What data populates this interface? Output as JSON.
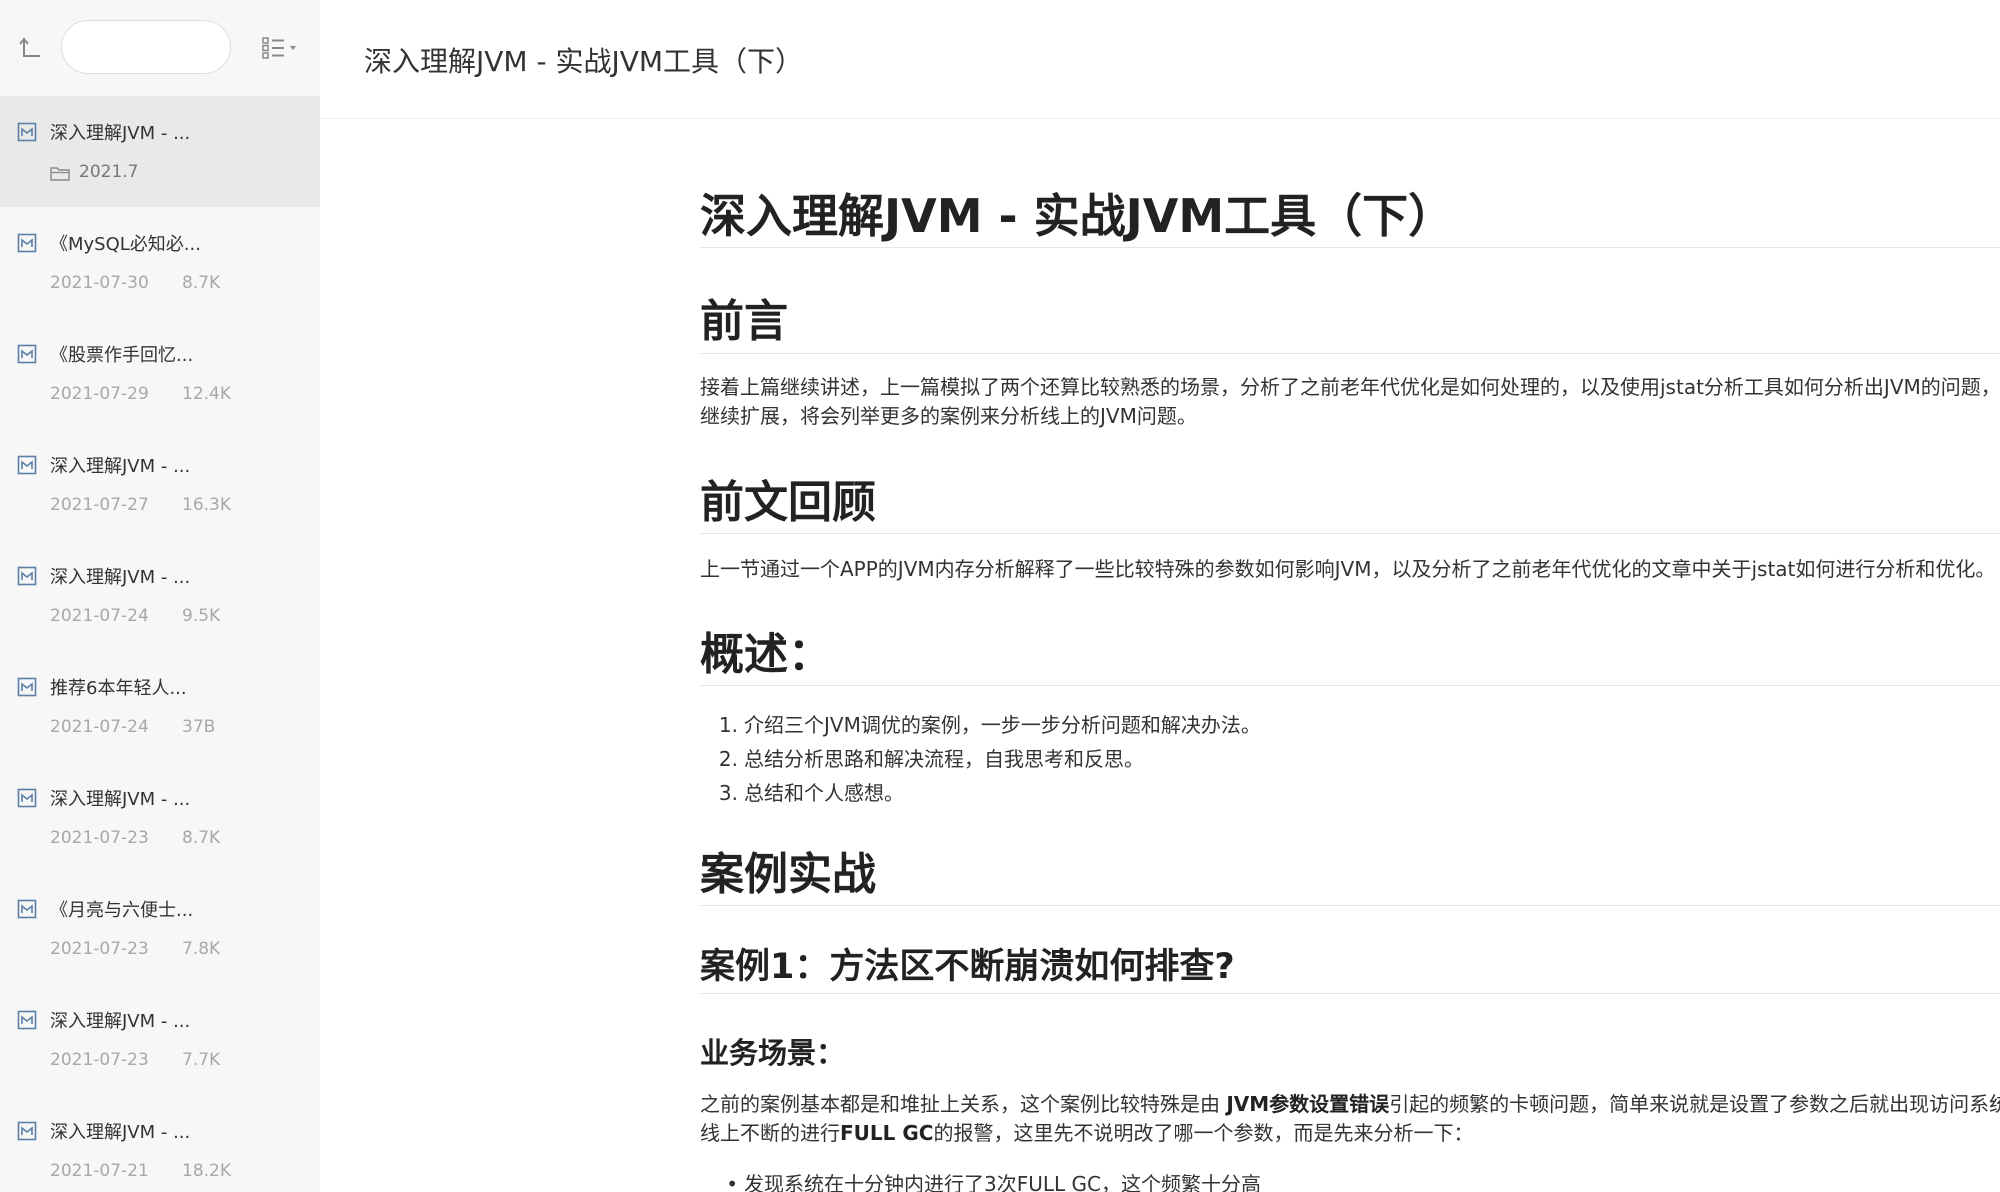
{
  "sidebar": {
    "search_value": "",
    "items": [
      {
        "title": "深入理解JVM - ...",
        "folder": "2021.7",
        "active": true
      },
      {
        "title": "《MySQL必知必...",
        "date": "2021-07-30",
        "size": "8.7K"
      },
      {
        "title": "《股票作手回忆...",
        "date": "2021-07-29",
        "size": "12.4K"
      },
      {
        "title": "深入理解JVM - ...",
        "date": "2021-07-27",
        "size": "16.3K"
      },
      {
        "title": "深入理解JVM - ...",
        "date": "2021-07-24",
        "size": "9.5K"
      },
      {
        "title": "推荐6本年轻人...",
        "date": "2021-07-24",
        "size": "37B"
      },
      {
        "title": "深入理解JVM - ...",
        "date": "2021-07-23",
        "size": "8.7K"
      },
      {
        "title": "《月亮与六便士...",
        "date": "2021-07-23",
        "size": "7.8K"
      },
      {
        "title": "深入理解JVM - ...",
        "date": "2021-07-23",
        "size": "7.7K"
      },
      {
        "title": "深入理解JVM - ...",
        "date": "2021-07-21",
        "size": "18.2K"
      }
    ]
  },
  "header": {
    "title": "深入理解JVM - 实战JVM工具（下）"
  },
  "article": {
    "h1": "深入理解JVM - 实战JVM工具（下）",
    "preface": {
      "heading": "前言",
      "para_line1": " 接着上篇继续讲述，上一篇模拟了两个还算比较熟悉的场景，分析了之前老年代优化是如何处理的，以及使用jstat分析工具如何分析出JVM的问题，这一",
      "para_line2": "继续扩展，将会列举更多的案例来分析线上的JVM问题。"
    },
    "review": {
      "heading": "前文回顾",
      "para": " 上一节通过一个APP的JVM内存分析解释了一些比较特殊的参数如何影响JVM，以及分析了之前老年代优化的文章中关于jstat如何进行分析和优化。"
    },
    "overview": {
      "heading": "概述：",
      "items": [
        {
          "num": "1.",
          "text": "介绍三个JVM调优的案例，一步一步分析问题和解决办法。"
        },
        {
          "num": "2.",
          "text": "总结分析思路和解决流程，自我思考和反思。"
        },
        {
          "num": "3.",
          "text": "总结和个人感想。"
        }
      ]
    },
    "cases": {
      "heading": "案例实战",
      "case1_heading": "案例1：方法区不断崩溃如何排查?",
      "biz_heading": "业务场景：",
      "biz_line1_a": " 之前的案例基本都是和堆扯上关系，这个案例比较特殊是由 ",
      "biz_line1_bold": "JVM参数设置错误",
      "biz_line1_b": "引起的频繁的卡顿问题，简单来说就是设置了参数之后就出现访问系统卡",
      "biz_line2_a": "线上不断的进行",
      "biz_line2_bold": "FULL GC",
      "biz_line2_b": "的报警，这里先不说明改了哪一个参数，而是先来分析一下：",
      "bullets": [
        {
          "bullet": "•",
          "text": "发现系统在十分钟内进行了3次FULL GC，这个频繁十分高"
        }
      ]
    }
  }
}
